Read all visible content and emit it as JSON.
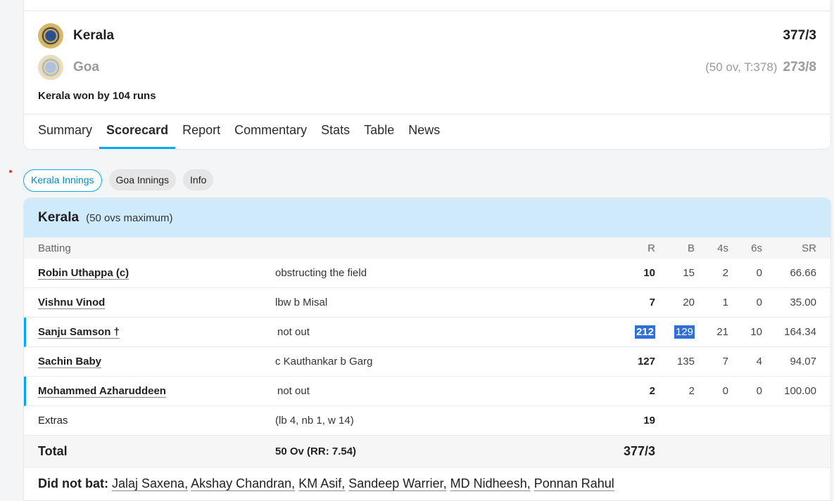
{
  "match": {
    "teams": [
      {
        "name": "Kerala",
        "score": "377/3",
        "info": ""
      },
      {
        "name": "Goa",
        "score": "273/8",
        "info": "(50 ov, T:378)"
      }
    ],
    "result": "Kerala won by 104 runs"
  },
  "tabs": [
    "Summary",
    "Scorecard",
    "Report",
    "Commentary",
    "Stats",
    "Table",
    "News"
  ],
  "active_tab": "Scorecard",
  "innings_pills": [
    "Kerala Innings",
    "Goa Innings",
    "Info"
  ],
  "innings": {
    "team": "Kerala",
    "subtitle": "(50 ovs maximum)",
    "headers": {
      "batting": "Batting",
      "r": "R",
      "b": "B",
      "fours": "4s",
      "sixes": "6s",
      "sr": "SR"
    },
    "batters": [
      {
        "name": "Robin Uthappa (c)",
        "dismissal": "obstructing the field",
        "r": "10",
        "b": "15",
        "fours": "2",
        "sixes": "0",
        "sr": "66.66"
      },
      {
        "name": "Vishnu Vinod",
        "dismissal": "lbw b Misal",
        "r": "7",
        "b": "20",
        "fours": "1",
        "sixes": "0",
        "sr": "35.00"
      },
      {
        "name": "Sanju Samson †",
        "dismissal": "not out",
        "r": "212",
        "b": "129",
        "fours": "21",
        "sixes": "10",
        "sr": "164.34"
      },
      {
        "name": "Sachin Baby",
        "dismissal": "c Kauthankar b Garg",
        "r": "127",
        "b": "135",
        "fours": "7",
        "sixes": "4",
        "sr": "94.07"
      },
      {
        "name": "Mohammed Azharuddeen",
        "dismissal": "not out",
        "r": "2",
        "b": "2",
        "fours": "0",
        "sixes": "0",
        "sr": "100.00"
      }
    ],
    "extras": {
      "label": "Extras",
      "detail": "(lb 4, nb 1, w 14)",
      "runs": "19"
    },
    "total": {
      "label": "Total",
      "overs": "50 Ov (RR: 7.54)",
      "score": "377/3"
    },
    "did_not_bat": {
      "label": "Did not bat:",
      "players": [
        "Jalaj Saxena,",
        "Akshay Chandran,",
        "KM Asif,",
        "Sandeep Warrier,",
        "MD Nidheesh,",
        "Ponnan Rahul"
      ]
    }
  },
  "colors": {
    "accent": "#03a9f4",
    "innings_header_bg": "#cfeafb",
    "selection": "#2f6fd6"
  }
}
